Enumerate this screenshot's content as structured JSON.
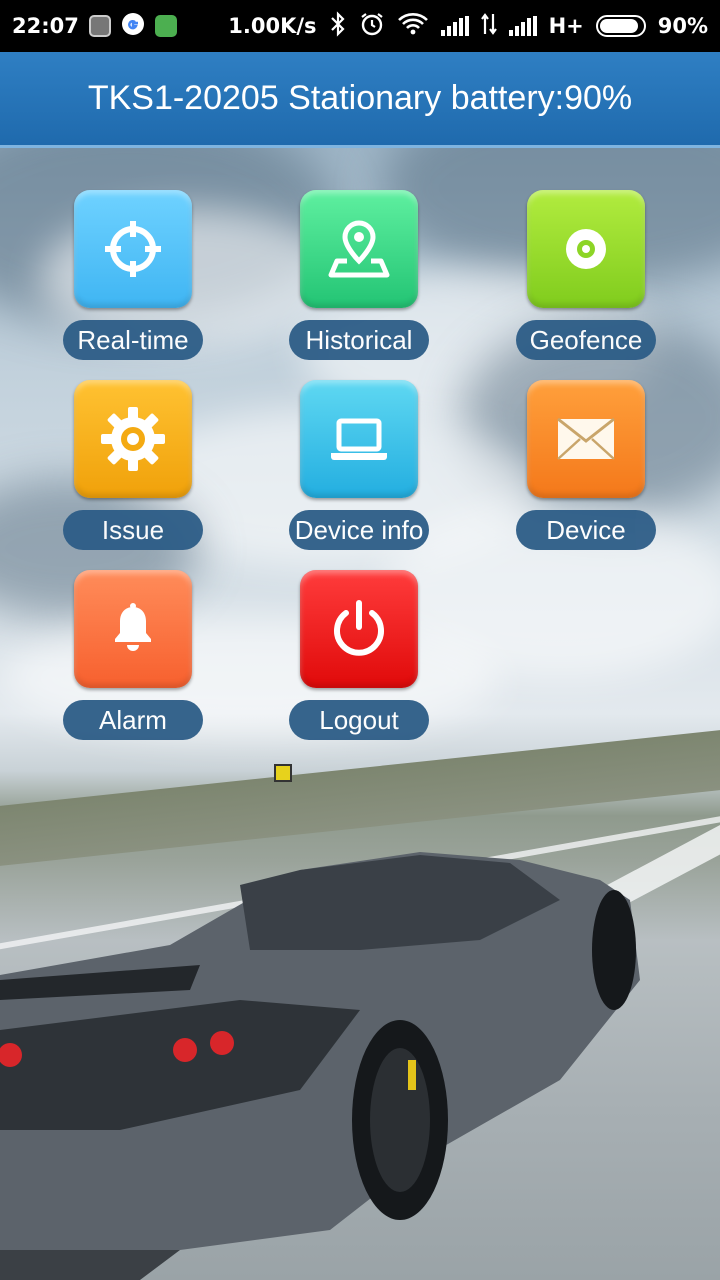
{
  "status_bar": {
    "time": "22:07",
    "net_speed": "1.00K/s",
    "network_type": "H+",
    "battery_text": "90%",
    "battery_level": 0.9,
    "icons": [
      "app-icon",
      "google-icon",
      "android-icon",
      "bluetooth-icon",
      "alarm-icon",
      "wifi-icon",
      "signal-icon",
      "data-transfer-icon",
      "signal-icon",
      "battery-icon"
    ]
  },
  "header": {
    "title": "TKS1-20205 Stationary battery:90%"
  },
  "menu": {
    "realtime": {
      "label": "Real-time",
      "icon": "crosshair-icon",
      "color": "#4cc3f7"
    },
    "historical": {
      "label": "Historical",
      "icon": "map-pin-icon",
      "color": "#33d584"
    },
    "geofence": {
      "label": "Geofence",
      "icon": "target-icon",
      "color": "#96dc2a"
    },
    "issue": {
      "label": "Issue",
      "icon": "gear-icon",
      "color": "#f5b01a"
    },
    "device_info": {
      "label": "Device info",
      "icon": "laptop-icon",
      "color": "#3bc3ea"
    },
    "device": {
      "label": "Device",
      "icon": "envelope-icon",
      "color": "#f88a26"
    },
    "alarm": {
      "label": "Alarm",
      "icon": "bell-icon",
      "color": "#fb7644"
    },
    "logout": {
      "label": "Logout",
      "icon": "power-icon",
      "color": "#f21f1f"
    }
  },
  "colors": {
    "header_bg": "#2573b8",
    "label_bg": "#2d5d87"
  }
}
